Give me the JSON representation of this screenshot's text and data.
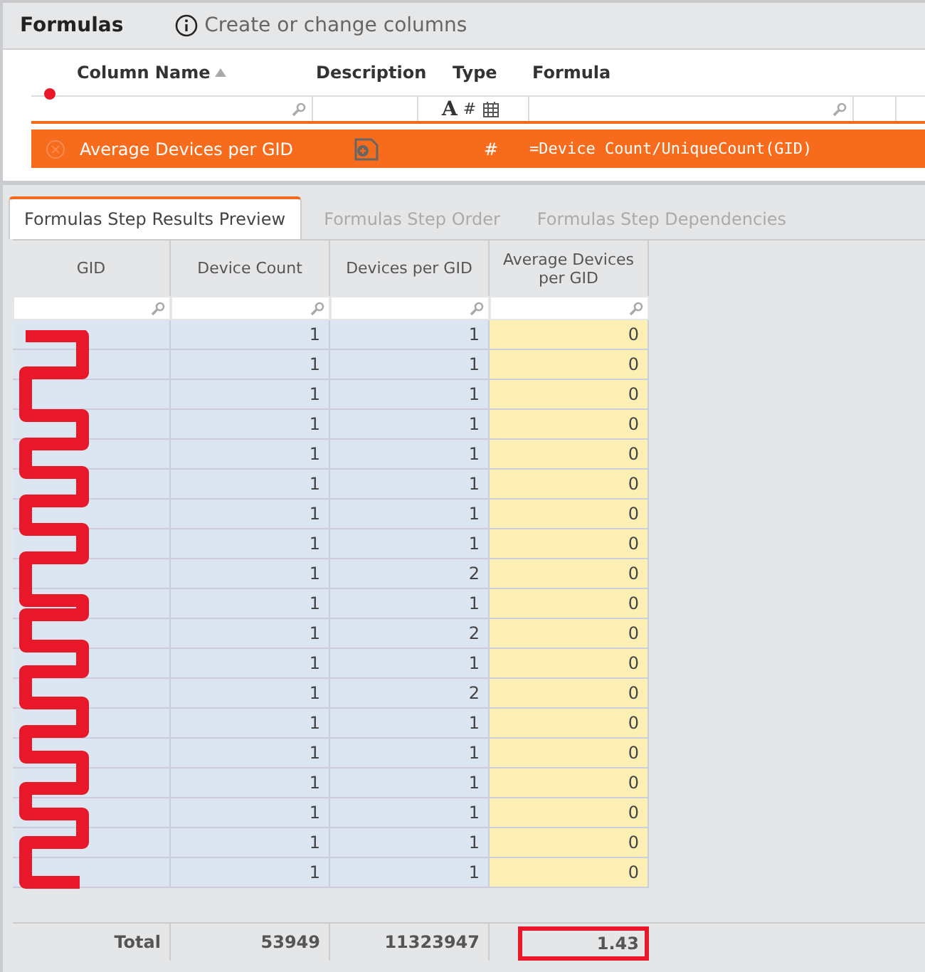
{
  "header": {
    "title": "Formulas",
    "hint": "Create or change columns"
  },
  "formulas": {
    "columns": [
      {
        "label": "Column Name",
        "sorted": true
      },
      {
        "label": "Description",
        "sorted": false
      },
      {
        "label": "Type",
        "sorted": false
      },
      {
        "label": "Formula",
        "sorted": false
      }
    ],
    "type_filter": [
      "A",
      "#"
    ],
    "rows": [
      {
        "name": "Average Devices per GID",
        "type": "#",
        "formula": "=Device Count/UniqueCount(GID)",
        "selected": true
      }
    ]
  },
  "tabs": [
    {
      "label": "Formulas Step Results Preview",
      "selected": true
    },
    {
      "label": "Formulas Step Order",
      "selected": false
    },
    {
      "label": "Formulas Step Dependencies",
      "selected": false
    }
  ],
  "grid": {
    "columns": [
      "GID",
      "Device Count",
      "Devices per GID",
      "Average Devices per GID"
    ],
    "rows": [
      [
        "1",
        "1",
        "0"
      ],
      [
        "1",
        "1",
        "0"
      ],
      [
        "1",
        "1",
        "0"
      ],
      [
        "1",
        "1",
        "0"
      ],
      [
        "1",
        "1",
        "0"
      ],
      [
        "1",
        "1",
        "0"
      ],
      [
        "1",
        "1",
        "0"
      ],
      [
        "1",
        "1",
        "0"
      ],
      [
        "1",
        "2",
        "0"
      ],
      [
        "1",
        "1",
        "0"
      ],
      [
        "1",
        "2",
        "0"
      ],
      [
        "1",
        "1",
        "0"
      ],
      [
        "1",
        "2",
        "0"
      ],
      [
        "1",
        "1",
        "0"
      ],
      [
        "1",
        "1",
        "0"
      ],
      [
        "1",
        "1",
        "0"
      ],
      [
        "1",
        "1",
        "0"
      ],
      [
        "1",
        "1",
        "0"
      ],
      [
        "1",
        "1",
        "0"
      ]
    ],
    "total": {
      "label": "Total",
      "values": [
        "53949",
        "11323947",
        "1.43"
      ]
    }
  }
}
